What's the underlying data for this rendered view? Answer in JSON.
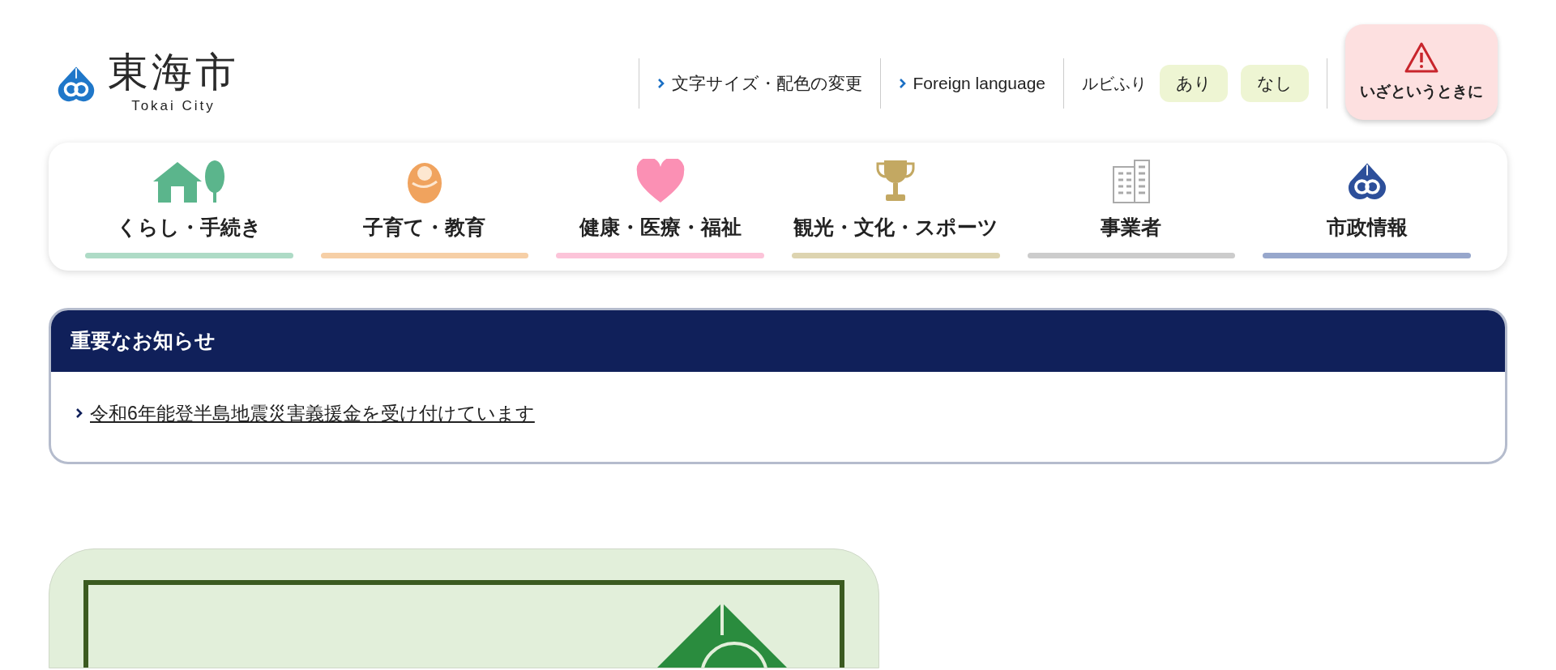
{
  "logo": {
    "name": "東海市",
    "subtitle": "Tokai City"
  },
  "utility_links": [
    {
      "label": "文字サイズ・配色の変更"
    },
    {
      "label": "Foreign language"
    }
  ],
  "ruby": {
    "label": "ルビふり",
    "options": [
      {
        "label": "あり"
      },
      {
        "label": "なし"
      }
    ]
  },
  "emergency_button": {
    "label": "いざというときに"
  },
  "categories": [
    {
      "label": "くらし・手続き",
      "kind": "house",
      "color": "#aedbc6"
    },
    {
      "label": "子育て・教育",
      "kind": "baby",
      "color": "#f6cfa6"
    },
    {
      "label": "健康・医療・福祉",
      "kind": "heart",
      "color": "#fcc4d9"
    },
    {
      "label": "観光・文化・スポーツ",
      "kind": "trophy",
      "color": "#ddd4b0"
    },
    {
      "label": "事業者",
      "kind": "building",
      "color": "#cccccc"
    },
    {
      "label": "市政情報",
      "kind": "emblem",
      "color": "#97a7cc"
    }
  ],
  "notice": {
    "title": "重要なお知らせ",
    "items": [
      {
        "text": "令和6年能登半島地震災害義援金を受け付けています"
      }
    ]
  }
}
